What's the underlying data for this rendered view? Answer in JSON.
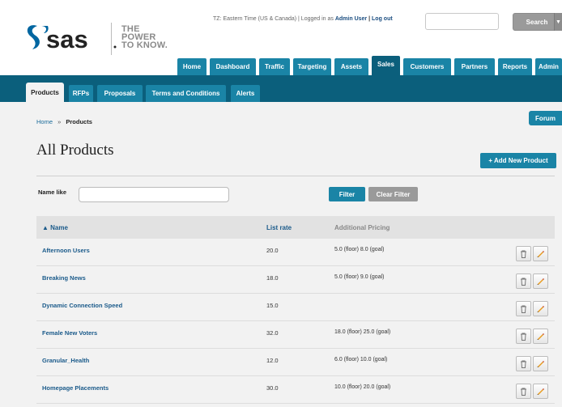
{
  "header": {
    "tagline": [
      "THE",
      "POWER",
      "TO KNOW."
    ],
    "timezone_text": "TZ: Eastern Time (US & Canada) | Logged in as",
    "user_name": "Admin User",
    "sep": "|",
    "logout_label": "Log out",
    "search_placeholder": "",
    "search_label": "Search",
    "search_caret": "▼"
  },
  "mainnav": [
    {
      "label": "Home"
    },
    {
      "label": "Dashboard"
    },
    {
      "label": "Traffic"
    },
    {
      "label": "Targeting"
    },
    {
      "label": "Assets"
    },
    {
      "label": "Sales"
    },
    {
      "label": "Customers"
    },
    {
      "label": "Partners"
    },
    {
      "label": "Reports"
    },
    {
      "label": "Admin"
    }
  ],
  "subtabs": [
    {
      "label": "Products"
    },
    {
      "label": "RFPs"
    },
    {
      "label": "Proposals"
    },
    {
      "label": "Terms and Conditions"
    },
    {
      "label": "Alerts"
    }
  ],
  "forum_label": "Forum",
  "breadcrumb": {
    "home": "Home",
    "sep": "»",
    "current": "Products"
  },
  "page_title": "All Products",
  "add_label": "+ Add New Product",
  "filter": {
    "label": "Name like",
    "value": "",
    "filter_label": "Filter",
    "clear_label": "Clear Filter"
  },
  "table": {
    "headers": {
      "name": "▲ Name",
      "rate": "List rate",
      "addl": "Additional Pricing"
    },
    "rows": [
      {
        "name": "Afternoon Users",
        "rate": "20.0",
        "addl": "5.0 (floor)  8.0 (goal)"
      },
      {
        "name": "Breaking News",
        "rate": "18.0",
        "addl": "5.0 (floor)  9.0 (goal)"
      },
      {
        "name": "Dynamic Connection Speed",
        "rate": "15.0",
        "addl": ""
      },
      {
        "name": "Female New Voters",
        "rate": "32.0",
        "addl": "18.0 (floor)  25.0 (goal)"
      },
      {
        "name": "Granular_Health",
        "rate": "12.0",
        "addl": "6.0 (floor)  10.0 (goal)"
      },
      {
        "name": "Homepage Placements",
        "rate": "30.0",
        "addl": "10.0 (floor)  20.0 (goal)"
      }
    ]
  },
  "colors": {
    "brand_blue": "#1a84a6",
    "nav_dark": "#0b5f7c",
    "logo_blue": "#0066a1",
    "link": "#1a5a8a"
  },
  "icons": {
    "delete": "trash-icon",
    "edit": "pencil-icon"
  }
}
